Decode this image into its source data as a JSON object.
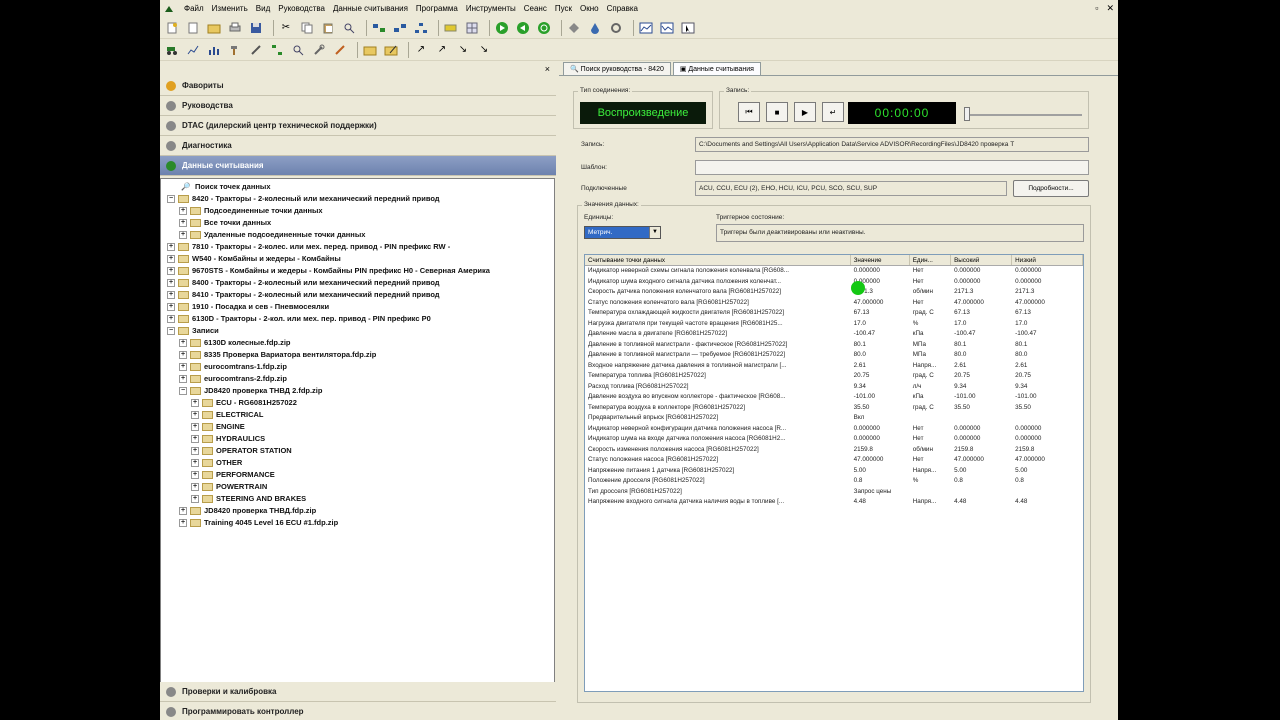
{
  "menu": [
    "Файл",
    "Изменить",
    "Вид",
    "Руководства",
    "Данные считывания",
    "Программа",
    "Инструменты",
    "Сеанс",
    "Пуск",
    "Окно",
    "Справка"
  ],
  "window_controls": [
    "▫",
    "✕"
  ],
  "left_panel": {
    "close": "×",
    "top_sections": [
      {
        "label": "Фавориты",
        "icon": "star-icon",
        "color": "#e0a020"
      },
      {
        "label": "Руководства",
        "icon": "book-icon",
        "color": "#888"
      },
      {
        "label": "DTAC (дилерский центр технической поддержки)",
        "icon": "support-icon",
        "color": "#888"
      },
      {
        "label": "Диагностика",
        "icon": "wrench-icon",
        "color": "#888"
      },
      {
        "label": "Данные считывания",
        "icon": "readings-icon",
        "color": "#2a8a2a"
      }
    ],
    "tree": [
      {
        "label": "Поиск точек данных",
        "level": 0,
        "exp": "",
        "folder": false
      },
      {
        "label": "8420 - Тракторы - 2-колесный или механический передний привод",
        "level": 0,
        "exp": "−",
        "folder": true
      },
      {
        "label": "Подсоединенные точки данных",
        "level": 1,
        "exp": "+",
        "folder": true
      },
      {
        "label": "Все точки данных",
        "level": 1,
        "exp": "+",
        "folder": true
      },
      {
        "label": "Удаленные подсоединенные точки данных",
        "level": 1,
        "exp": "+",
        "folder": true
      },
      {
        "label": "7810 - Тракторы - 2-колес. или мех. перед. привод - PIN префикс RW -",
        "level": 0,
        "exp": "+",
        "folder": true
      },
      {
        "label": "W540 - Комбайны и жедеры - Комбайны",
        "level": 0,
        "exp": "+",
        "folder": true
      },
      {
        "label": "9670STS - Комбайны и жедеры - Комбайны PIN префикс H0 - Северная Америка",
        "level": 0,
        "exp": "+",
        "folder": true
      },
      {
        "label": "8400 - Тракторы - 2-колесный или механический передний привод",
        "level": 0,
        "exp": "+",
        "folder": true
      },
      {
        "label": "8410 - Тракторы - 2-колесный или механический передний привод",
        "level": 0,
        "exp": "+",
        "folder": true
      },
      {
        "label": "1910 - Посадка и сев - Пневмосеялки",
        "level": 0,
        "exp": "+",
        "folder": true
      },
      {
        "label": "6130D - Тракторы - 2-кол. или мех. пер. привод - PIN префикс P0",
        "level": 0,
        "exp": "+",
        "folder": true
      },
      {
        "label": "Записи",
        "level": 0,
        "exp": "−",
        "folder": true
      },
      {
        "label": "6130D колесные.fdp.zip",
        "level": 1,
        "exp": "+",
        "folder": true
      },
      {
        "label": "8335 Проверка Вариатора вентилятора.fdp.zip",
        "level": 1,
        "exp": "+",
        "folder": true
      },
      {
        "label": "eurocomtrans-1.fdp.zip",
        "level": 1,
        "exp": "+",
        "folder": true
      },
      {
        "label": "eurocomtrans-2.fdp.zip",
        "level": 1,
        "exp": "+",
        "folder": true
      },
      {
        "label": "JD8420 проверка ТНВД 2.fdp.zip",
        "level": 1,
        "exp": "−",
        "folder": true
      },
      {
        "label": "ECU - RG6081H257022",
        "level": 2,
        "exp": "+",
        "folder": true
      },
      {
        "label": "ELECTRICAL",
        "level": 2,
        "exp": "+",
        "folder": true
      },
      {
        "label": "ENGINE",
        "level": 2,
        "exp": "+",
        "folder": true
      },
      {
        "label": "HYDRAULICS",
        "level": 2,
        "exp": "+",
        "folder": true
      },
      {
        "label": "OPERATOR STATION",
        "level": 2,
        "exp": "+",
        "folder": true
      },
      {
        "label": "OTHER",
        "level": 2,
        "exp": "+",
        "folder": true
      },
      {
        "label": "PERFORMANCE",
        "level": 2,
        "exp": "+",
        "folder": true
      },
      {
        "label": "POWERTRAIN",
        "level": 2,
        "exp": "+",
        "folder": true
      },
      {
        "label": "STEERING AND BRAKES",
        "level": 2,
        "exp": "+",
        "folder": true
      },
      {
        "label": "JD8420 проверка ТНВД.fdp.zip",
        "level": 1,
        "exp": "+",
        "folder": true
      },
      {
        "label": "Training 4045 Level 16 ECU #1.fdp.zip",
        "level": 1,
        "exp": "+",
        "folder": true
      }
    ],
    "bottom_sections": [
      {
        "label": "Проверки и калибровка",
        "icon": "check-icon",
        "color": "#888"
      },
      {
        "label": "Программировать контроллер",
        "icon": "program-icon",
        "color": "#888"
      }
    ]
  },
  "tabs": [
    "Поиск руководства - 8420",
    "Данные считывания"
  ],
  "playback": {
    "connection_type_label": "Тип соединения:",
    "mode": "Воспроизведение",
    "record_label": "Запись:",
    "timer": "00:00:00"
  },
  "fields": {
    "record_label": "Запись:",
    "record_value": "C:\\Documents and Settings\\All Users\\Application Data\\Service ADVISOR\\RecordingFiles\\JD8420 проверка Т",
    "template_label": "Шаблон:",
    "template_value": "",
    "connected_label": "Подключенные",
    "connected_value": "ACU, CCU, ECU (2), EHO, HCU, ICU, PCU, SCO, SCU, SUP",
    "details_button": "Подробности..."
  },
  "data_values": {
    "group_label": "Значения данных:",
    "units_label": "Единицы:",
    "units_value": "Метрич.",
    "trigger_label": "Триггерное состояние:",
    "trigger_value": "Триггеры были деактивированы или неактивны."
  },
  "table": {
    "headers": [
      "Считывание точки данных",
      "Значение",
      "Един...",
      "Высокий",
      "Низкий"
    ],
    "rows": [
      [
        "Индикатор неверной схемы сигнала положения коленвала [RG608...",
        "0.000000",
        "Нет",
        "0.000000",
        "0.000000"
      ],
      [
        "Индикатор шума входного сигнала датчика положения коленчат...",
        "0.000000",
        "Нет",
        "0.000000",
        "0.000000"
      ],
      [
        "Скорость датчика положения коленчатого вала [RG6081H257022]",
        "2171.3",
        "об/мин",
        "2171.3",
        "2171.3"
      ],
      [
        "Статус положения коленчатого вала [RG6081H257022]",
        "47.000000",
        "Нет",
        "47.000000",
        "47.000000"
      ],
      [
        "Температура охлаждающей жидкости двигателя [RG6081H257022]",
        "67.13",
        "град. С",
        "67.13",
        "67.13"
      ],
      [
        "Нагрузка двигателя при текущей частоте вращения [RG6081H25...",
        "17.0",
        "%",
        "17.0",
        "17.0"
      ],
      [
        "Давление масла в двигателе [RG6081H257022]",
        "-100.47",
        "кПа",
        "-100.47",
        "-100.47"
      ],
      [
        "Давление в топливной магистрали - фактическое [RG6081H257022]",
        "80.1",
        "МПа",
        "80.1",
        "80.1"
      ],
      [
        "Давление в топливной магистрали — требуемое [RG6081H257022]",
        "80.0",
        "МПа",
        "80.0",
        "80.0"
      ],
      [
        "Входное напряжение датчика давления в топливной магистрали [...",
        "2.61",
        "Напря...",
        "2.61",
        "2.61"
      ],
      [
        "Температура топлива [RG6081H257022]",
        "20.75",
        "град. С",
        "20.75",
        "20.75"
      ],
      [
        "Расход топлива [RG6081H257022]",
        "9.34",
        "л/ч",
        "9.34",
        "9.34"
      ],
      [
        "Давление воздуха во впускном коллекторе - фактическое [RG608...",
        "-101.00",
        "кПа",
        "-101.00",
        "-101.00"
      ],
      [
        "Температура воздуха в коллекторе [RG6081H257022]",
        "35.50",
        "град. С",
        "35.50",
        "35.50"
      ],
      [
        "Предварительный впрыск [RG6081H257022]",
        "Вкл",
        "",
        "",
        ""
      ],
      [
        "Индикатор неверной конфигурации датчика положения насоса [R...",
        "0.000000",
        "Нет",
        "0.000000",
        "0.000000"
      ],
      [
        "Индикатор шума на входе датчика положения насоса [RG6081H2...",
        "0.000000",
        "Нет",
        "0.000000",
        "0.000000"
      ],
      [
        "Скорость изменения положения насоса [RG6081H257022]",
        "2159.8",
        "об/мин",
        "2159.8",
        "2159.8"
      ],
      [
        "Статус положения насоса [RG6081H257022]",
        "47.000000",
        "Нет",
        "47.000000",
        "47.000000"
      ],
      [
        "Напряжение питания 1 датчика [RG6081H257022]",
        "5.00",
        "Напря...",
        "5.00",
        "5.00"
      ],
      [
        "Положение дросселя [RG6081H257022]",
        "0.8",
        "%",
        "0.8",
        "0.8"
      ],
      [
        "Тип дросселя [RG6081H257022]",
        "Запрос цены",
        "",
        "",
        ""
      ],
      [
        "Напряжение входного сигнала датчика наличия воды в топливе [...",
        "4.48",
        "Напря...",
        "4.48",
        "4.48"
      ]
    ]
  }
}
